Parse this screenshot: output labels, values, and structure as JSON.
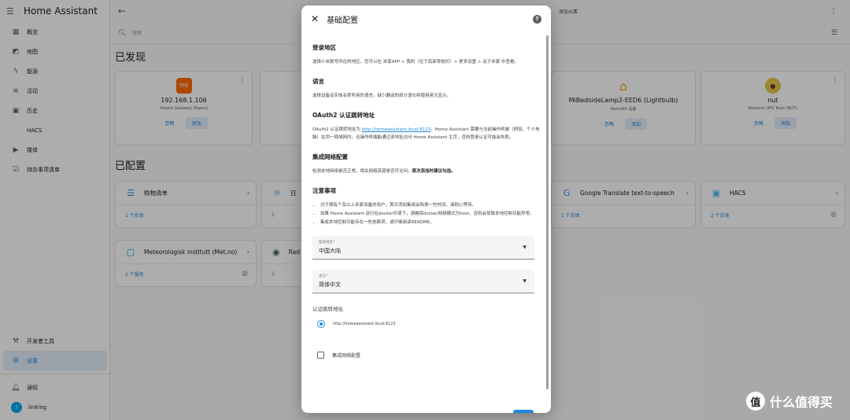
{
  "sidebar": {
    "title": "Home Assistant",
    "items": [
      {
        "label": "概览",
        "icon": "dashboard-icon"
      },
      {
        "label": "地图",
        "icon": "map-icon"
      },
      {
        "label": "能源",
        "icon": "bolt-icon"
      },
      {
        "label": "活动",
        "icon": "list-icon"
      },
      {
        "label": "历史",
        "icon": "chart-icon"
      },
      {
        "label": "HACS",
        "icon": ""
      },
      {
        "label": "媒体",
        "icon": "media-icon"
      },
      {
        "label": "待办事项清单",
        "icon": "checklist-icon"
      }
    ],
    "bottom": [
      {
        "label": "开发者工具",
        "icon": "wrench-icon"
      },
      {
        "label": "设置",
        "icon": "gear-icon"
      },
      {
        "label": "通知",
        "icon": "bell-icon"
      }
    ],
    "user": {
      "name": "linking",
      "initial": "l"
    }
  },
  "topbar": {
    "right_label": "添加元素"
  },
  "search": {
    "placeholder": "搜索"
  },
  "discovered": {
    "title": "已发现",
    "cards": [
      {
        "name": "192.168.1.106",
        "sub": "Xiaomi Gateway (Aqara)",
        "ignore": "忽略",
        "add": "添加",
        "logo_text": "mi"
      },
      {
        "name": "MiBedsideLamp2-EED6 (Lightbulb)",
        "sub": "HomeKit 设备",
        "ignore": "忽略",
        "add": "添加",
        "logo_text": ""
      },
      {
        "name": "nut",
        "sub": "Network UPS Tools (NUT)",
        "ignore": "忽略",
        "add": "添加",
        "logo_text": ""
      }
    ]
  },
  "configured": {
    "title": "已配置",
    "cards": [
      {
        "name": "购物清单",
        "foot": "1 个实体"
      },
      {
        "name": "日",
        "foot": "1"
      },
      {
        "name": "Google Translate text-to-speech",
        "foot": "1 个实体"
      },
      {
        "name": "HACS",
        "foot": "2 个实体"
      },
      {
        "name": "Meteorologisk institutt (Met.no)",
        "foot": "1 个服务"
      },
      {
        "name": "Rad",
        "foot": "1"
      }
    ]
  },
  "dialog": {
    "title": "基础配置",
    "s1_title": "登录地区",
    "s1_text": "选择小米账号所在的地区。您可以在 米家APP > 我的（位于底部导航栏）> 更多设置 > 关于米家 中查看。",
    "s2_title": "语言",
    "s2_text": "选择设备及实体名称所用的语言。缺少翻译的部分语句将使用英文显示。",
    "s3_title": "OAuth2 认证跳转地址",
    "s3_pre": "OAuth2 认证跳转地址为",
    "s3_link": "http://homeassistant.local:8123",
    "s3_post": "。Home Assistant 需要与当前操作终端（例如，个人电脑）在同一局域网内，且操作终端能通过该地址访问 Home Assistant 主页，否则登录认证可能会失败。",
    "s4_title": "集成网络配置",
    "s4_pre": "检测本地网络是否正常，相关网络资源是否可访问。",
    "s4_bold": "首次添加时建议勾选。",
    "s5_title": "注意事项",
    "notes": [
      "对于拥有个及以上米家设备的用户，首次添加集成会耗费一些时间，请耐心等待。",
      "如果 Home Assistant 运行在docker环境下，请确保docker网络模式为host，否则会导致本地控制功能异常。",
      "集成本地控制功能存在一些依赖项，请仔细阅读README。"
    ],
    "region_label": "登录地区*",
    "region_value": "中国大陆",
    "lang_label": "语言*",
    "lang_value": "简体中文",
    "redirect_label": "认证跳转地址",
    "redirect_option": "http://homeassistant.local:8123",
    "network_check_label": "集成网络配置"
  },
  "watermark": {
    "badge": "值",
    "text": "什么值得买"
  }
}
